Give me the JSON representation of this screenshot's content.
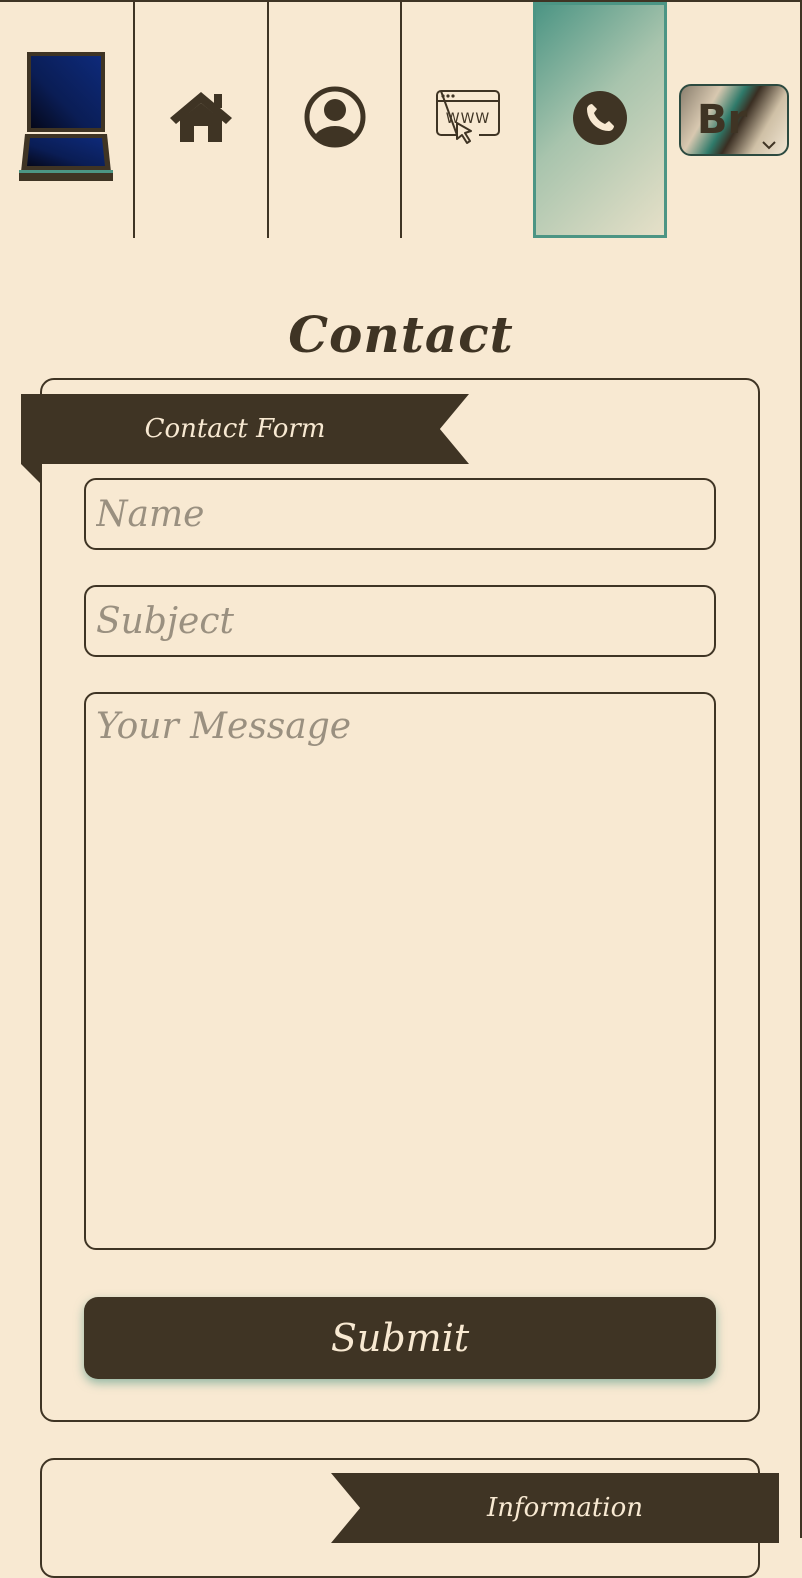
{
  "nav": {
    "items": [
      {
        "name": "logo",
        "icon": "laptop-icon"
      },
      {
        "name": "home",
        "icon": "home-icon"
      },
      {
        "name": "profile",
        "icon": "user-circle-icon"
      },
      {
        "name": "web",
        "icon": "browser-www-icon"
      },
      {
        "name": "contact",
        "icon": "phone-icon",
        "active": true
      }
    ],
    "language": {
      "label": "Br",
      "icon": "chevron-down-icon"
    }
  },
  "page": {
    "title": "Contact"
  },
  "contact_form": {
    "ribbon_label": "Contact Form",
    "name_placeholder": "Name",
    "subject_placeholder": "Subject",
    "message_placeholder": "Your Message",
    "submit_label": "Submit"
  },
  "information": {
    "ribbon_label": "Information"
  },
  "colors": {
    "background": "#f8e9d2",
    "ink": "#3f3424",
    "accent": "#4c9584",
    "placeholder": "#9a9080"
  }
}
